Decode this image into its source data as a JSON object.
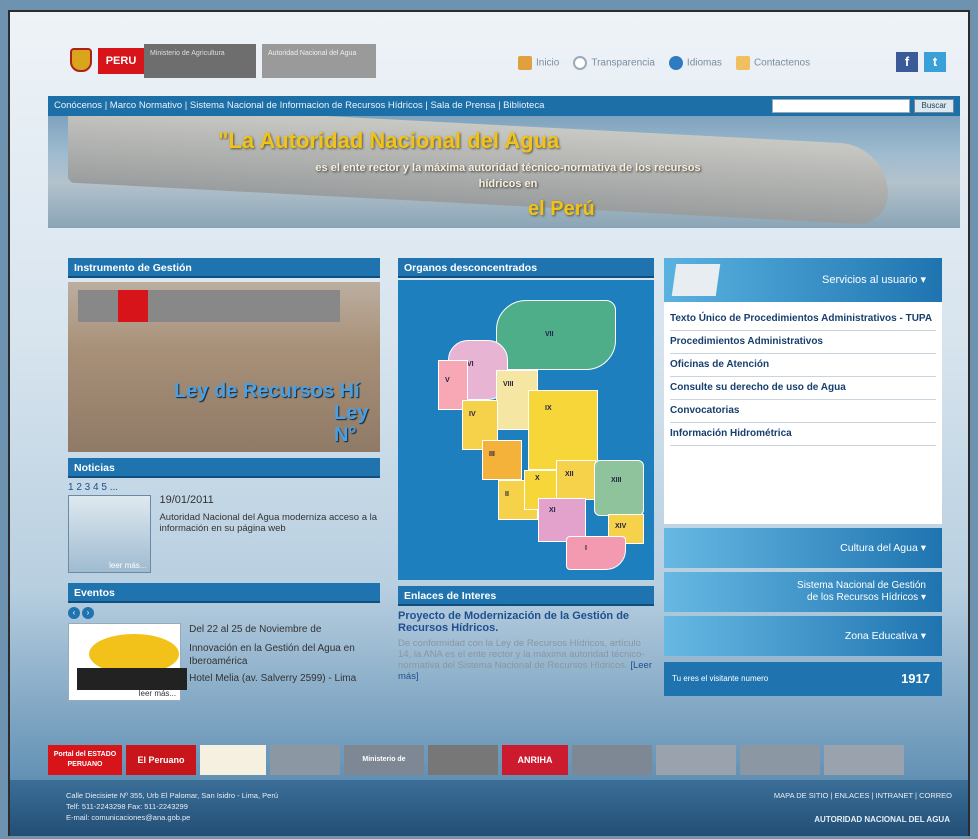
{
  "header": {
    "peru_logo": "PERU",
    "ministry1": "Ministerio de Agricultura",
    "ministry2": "Autoridad Nacional del Agua",
    "links": [
      {
        "label": "Inicio",
        "icon": "home-icon"
      },
      {
        "label": "Transparencia",
        "icon": "magnifier-icon"
      },
      {
        "label": "Idiomas",
        "icon": "globe-icon"
      },
      {
        "label": "Contactenos",
        "icon": "pencil-icon"
      }
    ],
    "social": [
      "f",
      "t"
    ]
  },
  "nav": {
    "items": "Conócenos | Marco Normativo | Sistema Nacional de Informacion de Recursos Hídricos | Sala de Prensa | Biblioteca",
    "search_button": "Buscar"
  },
  "banner": {
    "title": "\"La Autoridad Nacional del Agua",
    "subtitle": "es el ente rector y la máxima autoridad técnico-normativa de los recursos hídricos en",
    "peru": "el Perú"
  },
  "instrumento": {
    "heading": "Instrumento de Gestión",
    "image_text1": "Ley de Recursos Hí",
    "image_text2": "Ley N°"
  },
  "noticias": {
    "heading": "Noticias",
    "pager": "1 2 3 4 5 ...",
    "date": "19/01/2011",
    "text": "Autoridad Nacional del Agua moderniza acceso a la información en su página web",
    "more": "leer más..."
  },
  "eventos": {
    "heading": "Eventos",
    "date": "Del 22 al 25 de Noviembre de",
    "title": "Innovación en la Gestión del Agua en Iberoamérica",
    "place": "Hotel Melia (av. Salverry 2599) - Lima",
    "more": "leer más..."
  },
  "organos": {
    "heading": "Organos desconcentrados",
    "regions": [
      "VII",
      "VI",
      "VIII",
      "V",
      "IV",
      "IX",
      "III",
      "II",
      "X",
      "XII",
      "XIII",
      "XI",
      "XIV",
      "I"
    ]
  },
  "enlaces": {
    "heading": "Enlaces de Interes",
    "title": "Proyecto de Modernización de la Gestión de Recursos Hídricos.",
    "text": "De conformidad con la Ley de Recursos Hídricos, artículo 14, la ANA es el ente rector y la máxima autoridad técnico-normativa del Sistema Nacional de Recursos Hídricos.",
    "more": "[Leer más]"
  },
  "servicios": {
    "heading": "Servicios al usuario",
    "items": [
      "Texto Único de Procedimientos Administrativos - TUPA",
      "Procedimientos Administrativos",
      "Oficinas de Atención",
      "Consulte su derecho de uso de Agua",
      "Convocatorias",
      "Información Hidrométrica"
    ]
  },
  "side_buttons": {
    "cultura": "Cultura del Agua",
    "sistema_line1": "Sistema Nacional de Gestión",
    "sistema_line2": "de los Recursos Hídricos",
    "zona": "Zona Educativa"
  },
  "counter": {
    "label": "Tu eres el visitante numero",
    "value": "1917"
  },
  "logos": [
    "Portal del ESTADO PERUANO",
    "El Peruano",
    "Ministerio de Educación",
    "ANRIHA"
  ],
  "footer": {
    "address1": "Calle Diecisiete Nº 355, Urb El Palomar, San Isidro - Lima, Perú",
    "address2": "Telf: 511-2243298 Fax: 511-2243299",
    "email": "E-mail: comunicaciones@ana.gob.pe",
    "links": "MAPA DE SITIO | ENLACES | INTRANET | CORREO",
    "org": "AUTORIDAD NACIONAL DEL AGUA"
  },
  "colors": {
    "accent": "#1f74b0",
    "peru_red": "#d8141b",
    "gold": "#f2c21a"
  }
}
